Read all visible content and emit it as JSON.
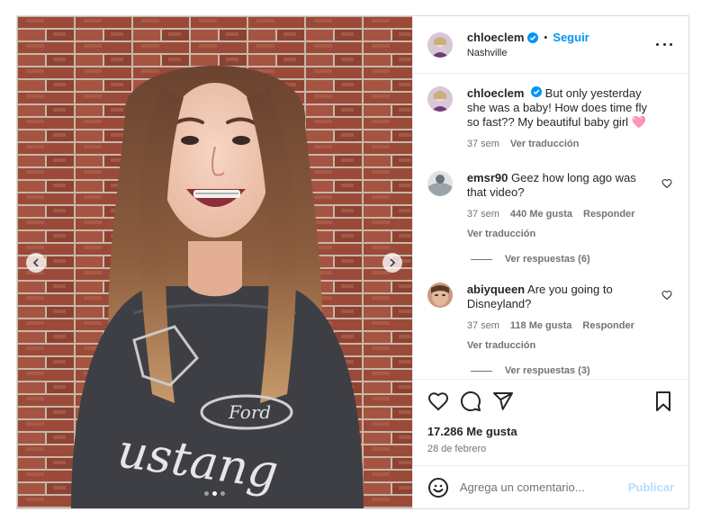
{
  "post": {
    "slide_count": 3,
    "active_slide": 2,
    "sweatshirt_text": "ustang",
    "sweatshirt_sub": "Ford"
  },
  "header": {
    "username": "chloeclem",
    "separator": "•",
    "follow_label": "Seguir",
    "location": "Nashville",
    "more_icon": "more-horizontal-icon"
  },
  "caption": {
    "username": "chloeclem",
    "text": "But only yesterday she was a baby! How does time fly so fast?? My beautiful baby girl 🩷",
    "time": "37 sem",
    "translate_label": "Ver traducción"
  },
  "comments": [
    {
      "username": "emsr90",
      "text": "Geez how long ago was that video?",
      "time": "37 sem",
      "likes": "440 Me gusta",
      "reply_label": "Responder",
      "translate_label": "Ver traducción",
      "view_replies": "Ver respuestas (6)"
    },
    {
      "username": "abiyqueen",
      "text": "Are you going to Disneyland?",
      "time": "37 sem",
      "likes": "118 Me gusta",
      "reply_label": "Responder",
      "translate_label": "Ver traducción",
      "view_replies": "Ver respuestas (3)"
    }
  ],
  "actions": {
    "likes_count": "17.286 Me gusta",
    "date": "28 de febrero"
  },
  "add_comment": {
    "placeholder": "Agrega un comentario...",
    "publish_label": "Publicar"
  },
  "colors": {
    "accent": "#0095f6",
    "verified": "#0095f6",
    "publish_disabled": "#b2dffc",
    "brick": "#9a4a38",
    "sweatshirt": "#3d3f44"
  }
}
